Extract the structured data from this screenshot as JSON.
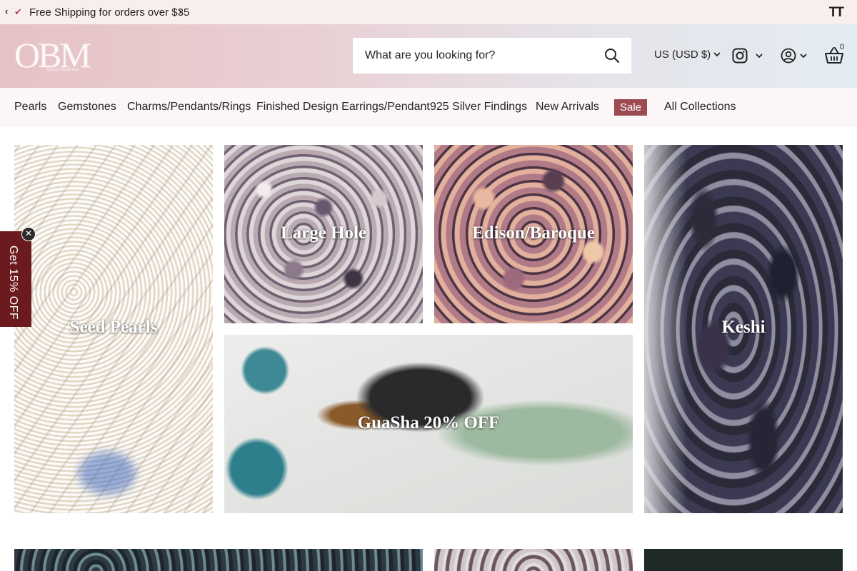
{
  "announcement": {
    "prev_icon": "chevron-left-icon",
    "check_icon": "check-icon",
    "message": "Free Shipping for orders over $35",
    "next_icon": "chevron-right-icon",
    "text_size_icon": "text-size-icon",
    "text_size_glyph": "TT"
  },
  "header": {
    "logo_text": "OBM",
    "logo_subtext": "Quality Bead Mart",
    "search_placeholder": "What are you looking for?",
    "currency": "US (USD $)",
    "cart_count": "0",
    "icons": [
      "search-icon",
      "instagram-icon",
      "account-icon",
      "basket-icon",
      "chevron-down-icon"
    ]
  },
  "nav": {
    "items": [
      "Pearls",
      "Gemstones",
      "Charms/Pendants/Rings",
      "Finished Design Earrings/Pendant",
      "925 Silver Findings",
      "New Arrivals",
      "Sale",
      "All Collections"
    ]
  },
  "collections": [
    {
      "label": "Seed Pearls"
    },
    {
      "label": "Large Hole"
    },
    {
      "label": "Edison/Baroque"
    },
    {
      "label": "Keshi"
    },
    {
      "label": "GuaSha 20% OFF"
    }
  ],
  "promo": {
    "label": "Get 15% OFF",
    "close_glyph": "✕"
  },
  "colors": {
    "accent": "#9b4b51",
    "promo_bg": "#6b1a1f",
    "announce_bg": "#f9eeee",
    "nav_bg": "#fdf6f6"
  }
}
